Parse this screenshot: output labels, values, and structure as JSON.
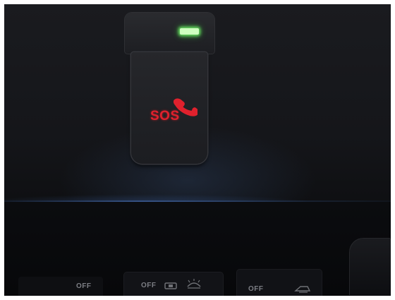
{
  "sos_module": {
    "sos_label": "SOS",
    "phone_icon": "phone-handset-icon",
    "led_color": "#b8ff9a",
    "sos_color": "#e0212d"
  },
  "controls": {
    "left_off_label": "OFF",
    "center_off_label": "OFF",
    "right_off_label": "OFF",
    "center_icons": [
      "map-light-icon",
      "dome-light-icon"
    ],
    "right_icon": "interior-light-icon"
  }
}
